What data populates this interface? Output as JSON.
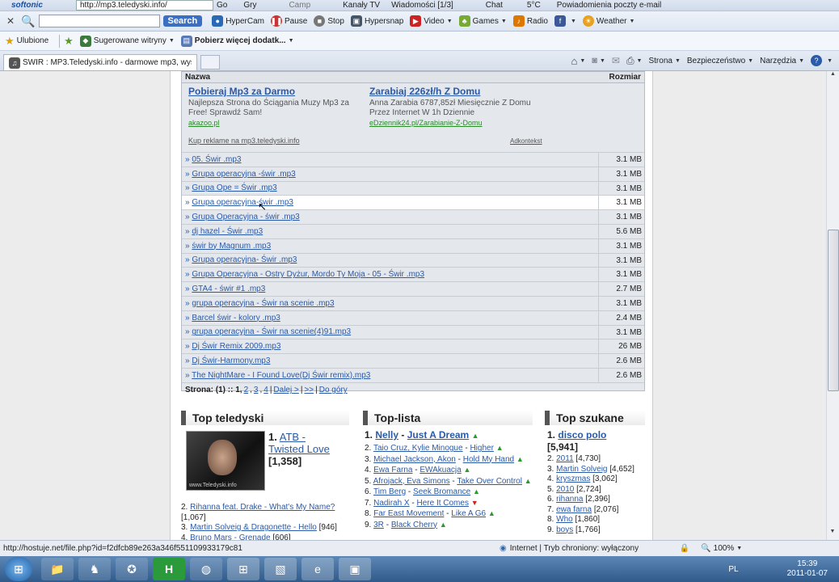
{
  "browser": {
    "topbar": {
      "logo": "softonic",
      "url": "http://mp3.teledyski.info/",
      "go": "Go",
      "gry": "Gry",
      "camp": "Camp",
      "kanaly": "Kanały TV",
      "wiadomosci": "Wiadomości [1/3]",
      "chat": "Chat",
      "temp": "5°C",
      "powiadomienia": "Powiadomienia poczty e-mail"
    },
    "toolbar": {
      "search_label": "Search",
      "hypercam": "HyperCam",
      "pause": "Pause",
      "stop": "Stop",
      "hypersnap": "Hypersnap",
      "video": "Video",
      "games": "Games",
      "radio": "Radio",
      "weather": "Weather"
    },
    "favbar": {
      "ulubione": "Ulubione",
      "sugerowane": "Sugerowane witryny",
      "pobierz": "Pobierz więcej dodatk..."
    },
    "tab": {
      "title": "ŚWIR : MP3.Teledyski.info - darmowe mp3, wysz..."
    },
    "cmdbar": {
      "strona": "Strona",
      "bezpieczenstwo": "Bezpieczeństwo",
      "narzedzia": "Narzędzia"
    }
  },
  "files": {
    "header_name": "Nazwa",
    "header_size": "Rozmiar",
    "ad1": {
      "title": "Pobieraj Mp3 za Darmo",
      "text": "Najlepsza Strona do Ściągania Muzy Mp3 za Free! Sprawdź Sam!",
      "url": "akazoo.pl"
    },
    "ad2": {
      "title": "Zarabiaj 226zł/h Z Domu",
      "text": "Anna Zarabia 6787,85zł Miesięcznie Z Domu Przez Internet W 1h Dziennie",
      "url": "eDziennik24.pl/Zarabianie-Z-Domu"
    },
    "ad_buy": "Kup reklame na mp3.teledyski.info",
    "ad_adkontekst": "Adkontekst",
    "rows": [
      {
        "name": "05. Świr .mp3",
        "size": "3.1 MB"
      },
      {
        "name": "Grupa operacyjna -świr .mp3",
        "size": "3.1 MB"
      },
      {
        "name": "Grupa Ope = Świr .mp3",
        "size": "3.1 MB"
      },
      {
        "name": "Grupa operacyjna-świr .mp3",
        "size": "3.1 MB"
      },
      {
        "name": "Grupa Operacyjna - świr .mp3",
        "size": "3.1 MB"
      },
      {
        "name": "dj hazel - Świr .mp3",
        "size": "5.6 MB"
      },
      {
        "name": "świr by Magnum .mp3",
        "size": "3.1 MB"
      },
      {
        "name": "Grupa operacyjna- Świr .mp3",
        "size": "3.1 MB"
      },
      {
        "name": "Grupa Operacyjna - Ostry Dyżur, Mordo Ty Moja - 05 - Świr .mp3",
        "size": "3.1 MB"
      },
      {
        "name": "GTA4 - świr #1 .mp3",
        "size": "2.7 MB"
      },
      {
        "name": "grupa operacyjna - Świr na scenie .mp3",
        "size": "3.1 MB"
      },
      {
        "name": "Barcel świr - kolory .mp3",
        "size": "2.4 MB"
      },
      {
        "name": "grupa operacyjna - Świr na scenie(4)91.mp3",
        "size": "3.1 MB"
      },
      {
        "name": "Dj Świr Remix 2009.mp3",
        "size": "26 MB"
      },
      {
        "name": "Dj Świr-Harmony.mp3",
        "size": "2.6 MB"
      },
      {
        "name": "The NightMare - I Found Love(Dj Świr remix).mp3",
        "size": "2.6 MB"
      }
    ],
    "pager": {
      "label": "Strona:",
      "current": "(1) :: 1,",
      "p2": "2",
      "p3": "3",
      "p4": "4",
      "sep": "|",
      "next": "Dalej >",
      "last": ">>",
      "top": "Do góry"
    }
  },
  "top_teledyski": {
    "title": "Top teledyski",
    "first": {
      "rank": "1.",
      "artist": "ATB -",
      "song": "Twisted Love",
      "count": "[1,358]",
      "watermark": "www.Teledyski.info"
    },
    "items": [
      {
        "rank": "2.",
        "text": "Rihanna feat. Drake - What's My Name?",
        "count": "[1,067]"
      },
      {
        "rank": "3.",
        "text": "Martin Solveig & Dragonette - Hello",
        "count": "[946]"
      },
      {
        "rank": "4.",
        "text": "Bruno Mars - Grenade",
        "count": "[606]"
      }
    ]
  },
  "top_lista": {
    "title": "Top-lista",
    "first": {
      "rank": "1.",
      "artist": "Nelly",
      "dash": "-",
      "song": "Just A Dream"
    },
    "items": [
      {
        "rank": "2.",
        "artist": "Taio Cruz, Kylie Minogue",
        "song": "Higher",
        "trend": "up"
      },
      {
        "rank": "3.",
        "artist": "Michael Jackson, Akon",
        "song": "Hold My Hand",
        "trend": "up"
      },
      {
        "rank": "4.",
        "artist": "Ewa Farna",
        "song": "EWAkuacja",
        "trend": "up"
      },
      {
        "rank": "5.",
        "artist": "Afrojack, Eva Simons",
        "song": "Take Over Control",
        "trend": "up"
      },
      {
        "rank": "6.",
        "artist": "Tim Berg",
        "song": "Seek Bromance",
        "trend": "up"
      },
      {
        "rank": "7.",
        "artist": "Nadirah X",
        "song": "Here It Comes",
        "trend": "down"
      },
      {
        "rank": "8.",
        "artist": "Far East Movement",
        "song": "Like A G6",
        "trend": "up"
      },
      {
        "rank": "9.",
        "artist": "3R",
        "song": "Black Cherry",
        "trend": "up"
      }
    ]
  },
  "top_szukane": {
    "title": "Top szukane",
    "first": {
      "rank": "1.",
      "term": "disco polo",
      "count": "[5,941]"
    },
    "items": [
      {
        "rank": "2.",
        "term": "2011",
        "count": "[4,730]"
      },
      {
        "rank": "3.",
        "term": "Martin Solveig",
        "count": "[4,652]"
      },
      {
        "rank": "4.",
        "term": "kryszmas",
        "count": "[3,062]"
      },
      {
        "rank": "5.",
        "term": "2010",
        "count": "[2,724]"
      },
      {
        "rank": "6.",
        "term": "rihanna",
        "count": "[2,396]"
      },
      {
        "rank": "7.",
        "term": "ewa farna",
        "count": "[2,076]"
      },
      {
        "rank": "8.",
        "term": "Who",
        "count": "[1,860]"
      },
      {
        "rank": "9.",
        "term": "boys",
        "count": "[1,766]"
      }
    ]
  },
  "status": {
    "url": "http://hostuje.net/file.php?id=f2dfcb89e263a346f551109933179c81",
    "zone": "Internet | Tryb chroniony: wyłączony",
    "zoom": "100%"
  },
  "taskbar": {
    "lang": "PL",
    "time": "15:39",
    "date": "2011-01-07"
  }
}
